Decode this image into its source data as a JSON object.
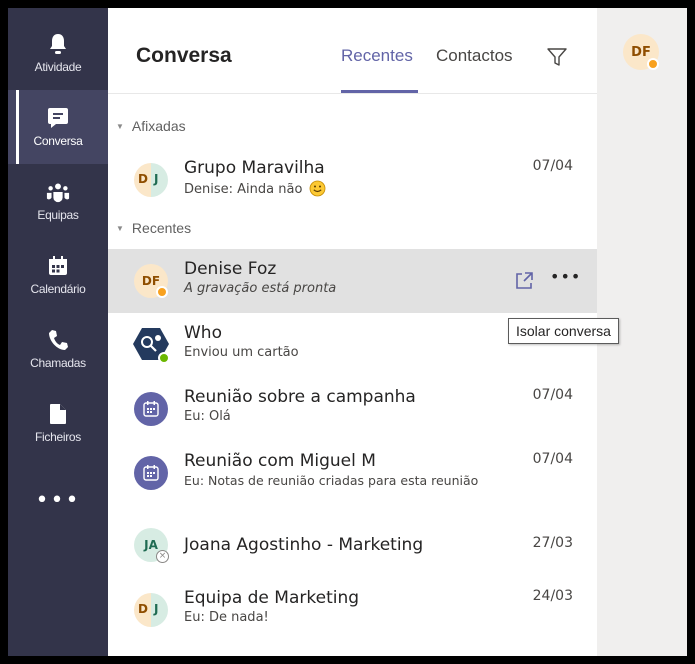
{
  "rail": {
    "items": [
      {
        "label": "Atividade",
        "icon": "bell-icon"
      },
      {
        "label": "Conversa",
        "icon": "chat-icon"
      },
      {
        "label": "Equipas",
        "icon": "teams-icon"
      },
      {
        "label": "Calendário",
        "icon": "calendar-icon"
      },
      {
        "label": "Chamadas",
        "icon": "phone-icon"
      },
      {
        "label": "Ficheiros",
        "icon": "file-icon"
      }
    ],
    "more_label": "•••",
    "active_index": 1
  },
  "header": {
    "title": "Conversa",
    "tabs": [
      "Recentes",
      "Contactos"
    ],
    "active_tab": "Recentes"
  },
  "sections": {
    "pinned": "Afixadas",
    "recent": "Recentes"
  },
  "chats": [
    {
      "name": "Grupo Maravilha",
      "preview": "Denise: Ainda não",
      "date": "07/04",
      "initials": [
        "D",
        "J"
      ]
    },
    {
      "name": "Denise Foz",
      "preview": "A gravação está pronta",
      "date": "",
      "initials": "DF"
    },
    {
      "name": "Who",
      "preview": "Enviou um cartão",
      "date": ""
    },
    {
      "name": "Reunião sobre a campanha",
      "preview": "Eu: Olá",
      "date": "07/04"
    },
    {
      "name": "Reunião com Miguel M",
      "preview": "Eu: Notas de reunião criadas para esta reunião",
      "date": "07/04"
    },
    {
      "name": "Joana Agostinho - Marketing",
      "preview": "",
      "date": "27/03",
      "initials": "JA"
    },
    {
      "name": "Equipa de Marketing",
      "preview": "Eu: De nada!",
      "date": "24/03",
      "initials": [
        "D",
        "J"
      ]
    }
  ],
  "tooltip": "Isolar conversa",
  "row_more_label": "•••",
  "profile": {
    "initials": "DF"
  },
  "colors": {
    "accent": "#6264a7",
    "rail_bg": "#33344a",
    "away": "#f8a11f",
    "available": "#6bb700"
  }
}
